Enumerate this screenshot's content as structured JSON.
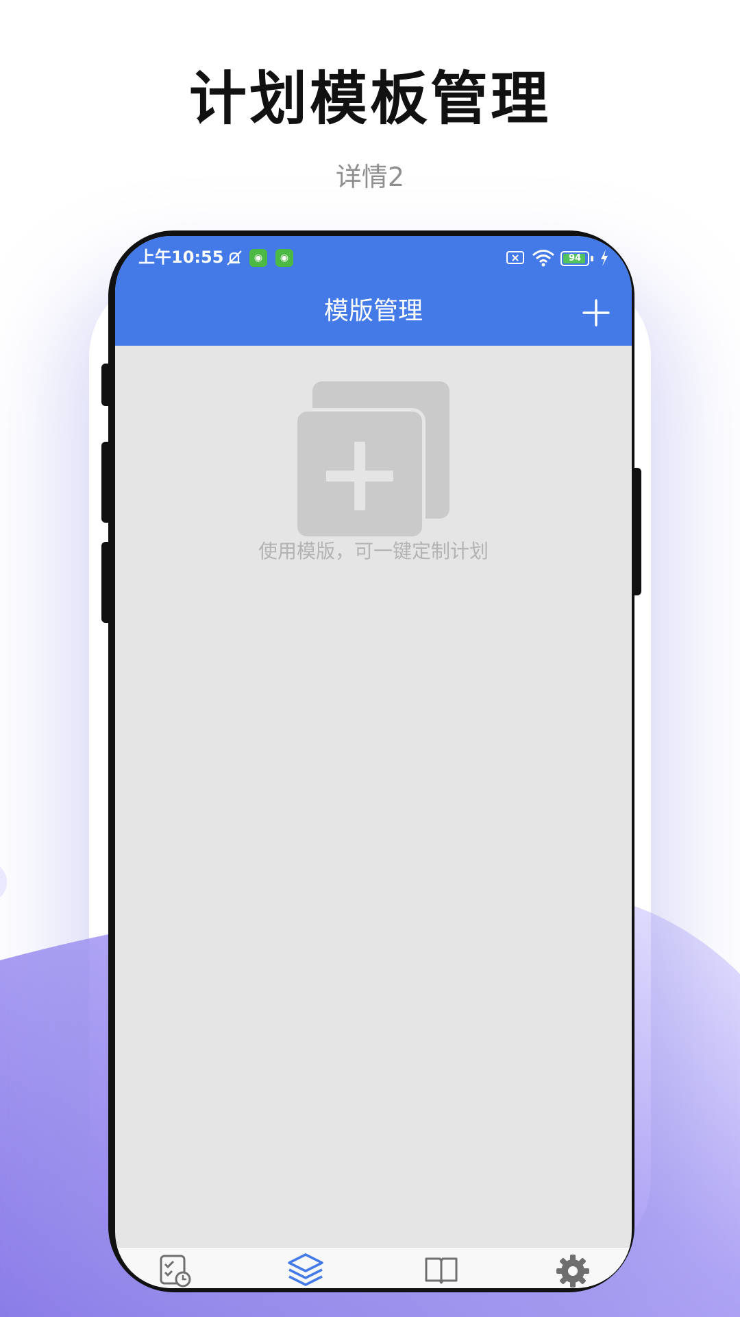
{
  "promo": {
    "title": "计划模板管理",
    "subtitle": "详情2"
  },
  "status_bar": {
    "time": "上午10:55",
    "battery_level": "94",
    "battery_fraction": 0.94,
    "icons": [
      "mute-notification-icon",
      "app-notification-icon",
      "app-notification-icon",
      "no-sim-icon",
      "wifi-icon",
      "battery-icon",
      "charging-icon"
    ]
  },
  "app_bar": {
    "title": "模版管理",
    "add_icon": "plus-icon"
  },
  "empty_state": {
    "icon": "add-template-icon",
    "message": "使用模版，可一键定制计划"
  },
  "tab_bar": {
    "tabs": [
      {
        "icon": "schedule-checklist-icon",
        "label": "",
        "active": false
      },
      {
        "icon": "layers-icon",
        "label": "",
        "active": true
      },
      {
        "icon": "book-icon",
        "label": "",
        "active": false
      },
      {
        "icon": "gear-icon",
        "label": "",
        "active": false
      }
    ]
  },
  "colors": {
    "primary": "#437ae8",
    "screen_background": "#e5e5e5",
    "empty_icon": "#cacaca",
    "active_tab": "#437ae8",
    "inactive_tab": "#6e6e6e",
    "wave_gradient": [
      "#8f80e8",
      "#c8c4fb"
    ]
  }
}
